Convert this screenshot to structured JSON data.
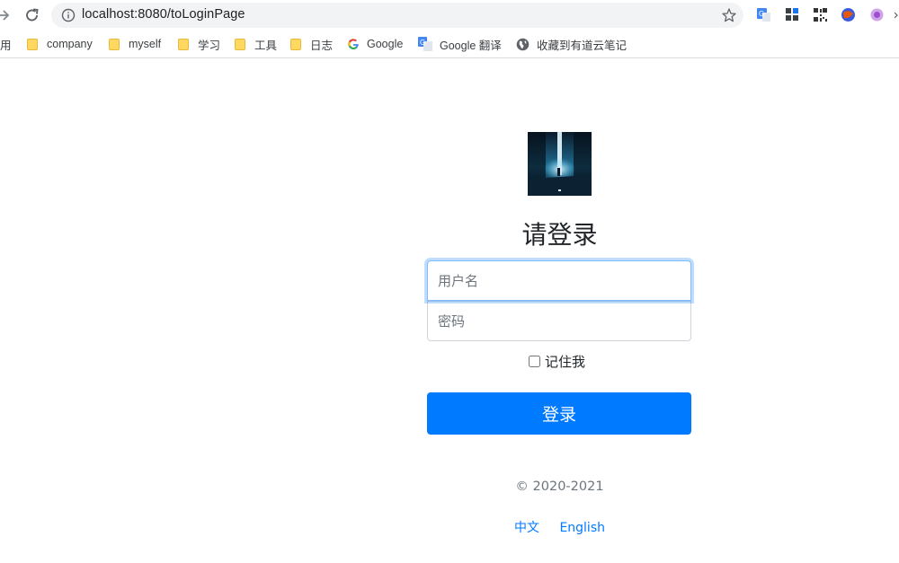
{
  "browser": {
    "url": "localhost:8080/toLoginPage",
    "bookmarks": [
      {
        "label": "用",
        "type": "text"
      },
      {
        "label": "company",
        "type": "folder"
      },
      {
        "label": "myself",
        "type": "folder"
      },
      {
        "label": "学习",
        "type": "folder"
      },
      {
        "label": "工具",
        "type": "folder"
      },
      {
        "label": "日志",
        "type": "folder"
      },
      {
        "label": "Google",
        "type": "google"
      },
      {
        "label": "Google 翻译",
        "type": "translate"
      },
      {
        "label": "收藏到有道云笔记",
        "type": "globe"
      }
    ]
  },
  "login": {
    "title": "请登录",
    "username_placeholder": "用户名",
    "password_placeholder": "密码",
    "remember_label": "记住我",
    "submit_label": "登录",
    "copyright": "© 2020-2021",
    "lang_zh": "中文",
    "lang_en": "English"
  },
  "colors": {
    "primary": "#007bff",
    "focus_border": "#80bdff",
    "muted_text": "#6c757d"
  }
}
